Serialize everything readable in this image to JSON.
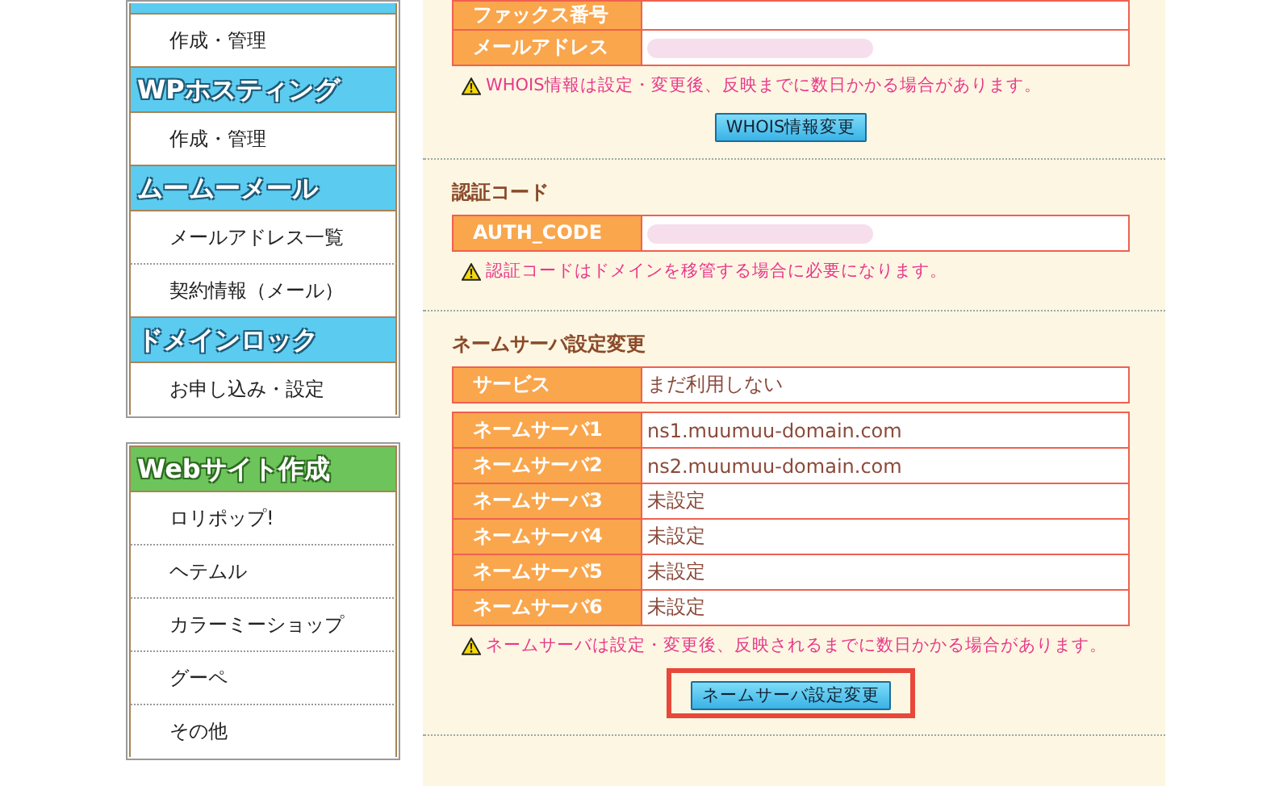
{
  "sidebar": {
    "panels": [
      {
        "groups": [
          {
            "color": "#5ccbf0",
            "items": [
              "作成・管理"
            ]
          },
          {
            "title": "WPホスティング",
            "color": "#5ccbf0",
            "items": [
              "作成・管理"
            ]
          },
          {
            "title": "ムームーメール",
            "color": "#5ccbf0",
            "items": [
              "メールアドレス一覧",
              "契約情報（メール）"
            ]
          },
          {
            "title": "ドメインロック",
            "color": "#5ccbf0",
            "items": [
              "お申し込み・設定"
            ]
          }
        ]
      },
      {
        "groups": [
          {
            "title": "Webサイト作成",
            "color": "#6cc45a",
            "items": [
              "ロリポップ!",
              "ヘテムル",
              "カラーミーショップ",
              "グーペ",
              "その他"
            ]
          }
        ]
      }
    ]
  },
  "sections": [
    {
      "tables": [
        [
          {
            "label": "ファックス番号"
          },
          {
            "label": "メールアドレス",
            "redacted": true
          }
        ]
      ],
      "notice": "WHOIS情報は設定・変更後、反映までに数日かかる場合があります。",
      "button": {
        "label": "WHOIS情報変更",
        "highlighted": false
      }
    },
    {
      "heading": "認証コード",
      "tables": [
        [
          {
            "label": "AUTH_CODE",
            "redacted": true
          }
        ]
      ],
      "notice": "認証コードはドメインを移管する場合に必要になります。"
    },
    {
      "heading": "ネームサーバ設定変更",
      "tables": [
        [
          {
            "label": "サービス",
            "value": "まだ利用しない"
          }
        ],
        [
          {
            "label": "ネームサーバ1",
            "value": "ns1.muumuu-domain.com"
          },
          {
            "label": "ネームサーバ2",
            "value": "ns2.muumuu-domain.com"
          },
          {
            "label": "ネームサーバ3",
            "value": "未設定"
          },
          {
            "label": "ネームサーバ4",
            "value": "未設定"
          },
          {
            "label": "ネームサーバ5",
            "value": "未設定"
          },
          {
            "label": "ネームサーバ6",
            "value": "未設定"
          }
        ]
      ],
      "notice": "ネームサーバは設定・変更後、反映されるまでに数日かかる場合があります。",
      "button": {
        "label": "ネームサーバ設定変更",
        "highlighted": true
      }
    }
  ]
}
